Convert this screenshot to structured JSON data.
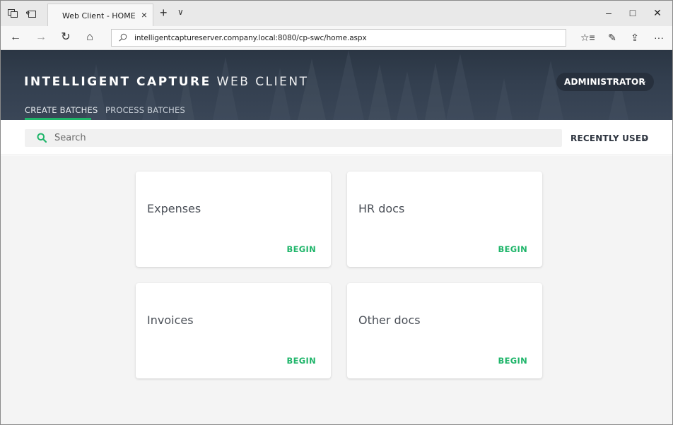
{
  "browser": {
    "tab_title": "Web Client - HOME",
    "tab_close": "×",
    "new_tab": "+",
    "tab_menu": "∨",
    "url": "intelligentcaptureserver.company.local:8080/cp-swc/home.aspx",
    "window_controls": {
      "minimize": "–",
      "maximize": "□",
      "close": "✕"
    },
    "nav_icons": {
      "back": "←",
      "forward": "→",
      "refresh": "↻",
      "home": "⌂"
    },
    "toolbar_icons": {
      "favorites": "☆≡",
      "notes": "✎",
      "share": "⇪",
      "more": "···"
    }
  },
  "header": {
    "brand_bold": "INTELLIGENT CAPTURE",
    "brand_light": "WEB CLIENT",
    "tabs": [
      {
        "label": "CREATE BATCHES",
        "active": true
      },
      {
        "label": "PROCESS BATCHES",
        "active": false
      }
    ],
    "user_menu": {
      "label": "ADMINISTRATOR",
      "chevron": "⌄"
    },
    "accent_color": "#1fb56a"
  },
  "search": {
    "placeholder": "Search",
    "sort_label": "RECENTLY USED",
    "sort_chevron": "⌄"
  },
  "cards": [
    {
      "title": "Expenses",
      "action": "BEGIN"
    },
    {
      "title": "HR docs",
      "action": "BEGIN"
    },
    {
      "title": "Invoices",
      "action": "BEGIN"
    },
    {
      "title": "Other docs",
      "action": "BEGIN"
    }
  ]
}
